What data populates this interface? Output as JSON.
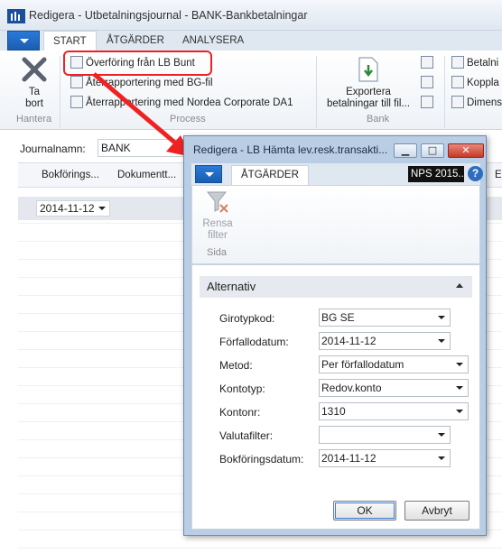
{
  "main_window": {
    "title": "Redigera - Utbetalningsjournal - BANK-Bankbetalningar",
    "tabs": [
      "START",
      "ÅTGÄRDER",
      "ANALYSERA"
    ],
    "active_tab": "START"
  },
  "ribbon": {
    "take_away": "Ta\nbort",
    "group_manage": "Hantera",
    "transfer_bunt": "Överföring från LB Bunt",
    "resend_bg": "Återrapportering med BG-fil",
    "resend_nordea": "Återrapportering med Nordea Corporate DA1",
    "group_process": "Process",
    "export_payments": "Exportera\nbetalningar till fil...",
    "group_bank": "Bank",
    "bank_items": [
      "Betalni",
      "Koppla",
      "Dimens"
    ]
  },
  "journal": {
    "name_label": "Journalnamn:",
    "name_value": "BANK",
    "columns": [
      "Bokförings...",
      "Dokumentt..."
    ],
    "right_col_fragment": "E",
    "row_date": "2014-11-12"
  },
  "dialog": {
    "title": "Redigera - LB Hämta lev.resk.transakti...",
    "tab": "ÅTGÄRDER",
    "badge": "NPS 2015...",
    "help": "?",
    "clear_filter": "Rensa\nfilter",
    "group_page": "Sida",
    "section": "Alternativ",
    "fields": [
      {
        "label": "Girotypkod:",
        "value": "BG SE"
      },
      {
        "label": "Förfallodatum:",
        "value": "2014-11-12"
      },
      {
        "label": "Metod:",
        "value": "Per förfallodatum"
      },
      {
        "label": "Kontotyp:",
        "value": "Redov.konto"
      },
      {
        "label": "Kontonr:",
        "value": "1310"
      },
      {
        "label": "Valutafilter:",
        "value": ""
      },
      {
        "label": "Bokföringsdatum:",
        "value": "2014-11-12"
      }
    ],
    "ok": "OK",
    "cancel": "Avbryt"
  },
  "colors": {
    "accent": "#1a5db3",
    "highlight": "#e22222",
    "dialog_frame": "#b9cde5"
  }
}
